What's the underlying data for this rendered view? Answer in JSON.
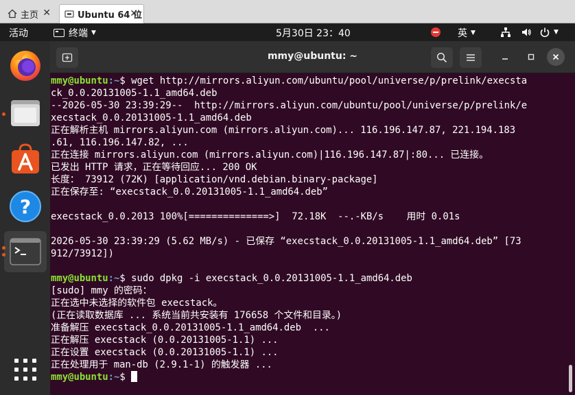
{
  "host_tabs": [
    {
      "label": "主页",
      "icon": "home-icon"
    },
    {
      "label": "Ubuntu 64 位",
      "icon": "vm-icon"
    }
  ],
  "topbar": {
    "activities": "活动",
    "app_name": "终端",
    "clock": "5月30日  23：40",
    "input_method": "英"
  },
  "dock": [
    {
      "name": "firefox",
      "icon": "firefox-icon"
    },
    {
      "name": "files",
      "icon": "files-icon"
    },
    {
      "name": "software",
      "icon": "app-store-icon"
    },
    {
      "name": "help",
      "icon": "help-icon"
    },
    {
      "name": "terminal",
      "icon": "terminal-icon"
    },
    {
      "name": "show-apps",
      "icon": "show-apps-icon"
    }
  ],
  "terminal": {
    "title": "mmy@ubuntu: ~",
    "prompt_user": "mmy@ubuntu",
    "prompt_path": ":~",
    "lines": [
      {
        "type": "prompt",
        "cmd": "$ wget http://mirrors.aliyun.com/ubuntu/pool/universe/p/prelink/execsta"
      },
      {
        "type": "out",
        "text": "ck_0.0.20131005-1.1_amd64.deb"
      },
      {
        "type": "out",
        "text": "--2026-05-30 23:39:29--  http://mirrors.aliyun.com/ubuntu/pool/universe/p/prelink/e"
      },
      {
        "type": "out",
        "text": "xecstack_0.0.20131005-1.1_amd64.deb"
      },
      {
        "type": "out",
        "text": "正在解析主机 mirrors.aliyun.com (mirrors.aliyun.com)... 116.196.147.87, 221.194.183"
      },
      {
        "type": "out",
        "text": ".61, 116.196.147.82, ..."
      },
      {
        "type": "out",
        "text": "正在连接 mirrors.aliyun.com (mirrors.aliyun.com)|116.196.147.87|:80... 已连接。"
      },
      {
        "type": "out",
        "text": "已发出 HTTP 请求，正在等待回应... 200 OK"
      },
      {
        "type": "out",
        "text": "长度： 73912 (72K) [application/vnd.debian.binary-package]"
      },
      {
        "type": "out",
        "text": "正在保存至: “execstack_0.0.20131005-1.1_amd64.deb”"
      },
      {
        "type": "out",
        "text": ""
      },
      {
        "type": "out",
        "text": "execstack_0.0.2013 100%[==============>]  72.18K  --.-KB/s    用时 0.01s"
      },
      {
        "type": "out",
        "text": ""
      },
      {
        "type": "out",
        "text": "2026-05-30 23:39:29 (5.62 MB/s) - 已保存 “execstack_0.0.20131005-1.1_amd64.deb” [73"
      },
      {
        "type": "out",
        "text": "912/73912])"
      },
      {
        "type": "out",
        "text": ""
      },
      {
        "type": "prompt",
        "cmd": "$ sudo dpkg -i execstack_0.0.20131005-1.1_amd64.deb"
      },
      {
        "type": "out",
        "text": "[sudo] mmy 的密码："
      },
      {
        "type": "out",
        "text": "正在选中未选择的软件包 execstack。"
      },
      {
        "type": "out",
        "text": "(正在读取数据库 ... 系统当前共安装有 176658 个文件和目录。)"
      },
      {
        "type": "out",
        "text": "准备解压 execstack_0.0.20131005-1.1_amd64.deb  ..."
      },
      {
        "type": "out",
        "text": "正在解压 execstack (0.0.20131005-1.1) ..."
      },
      {
        "type": "out",
        "text": "正在设置 execstack (0.0.20131005-1.1) ..."
      },
      {
        "type": "out",
        "text": "正在处理用于 man-db (2.9.1-1) 的触发器 ..."
      },
      {
        "type": "prompt",
        "cmd": "$ ",
        "cursor": true
      }
    ]
  },
  "colors": {
    "terminal_bg": "#300a24",
    "prompt_user": "#8ae234",
    "prompt_path": "#729fcf",
    "accent": "#e95420"
  }
}
